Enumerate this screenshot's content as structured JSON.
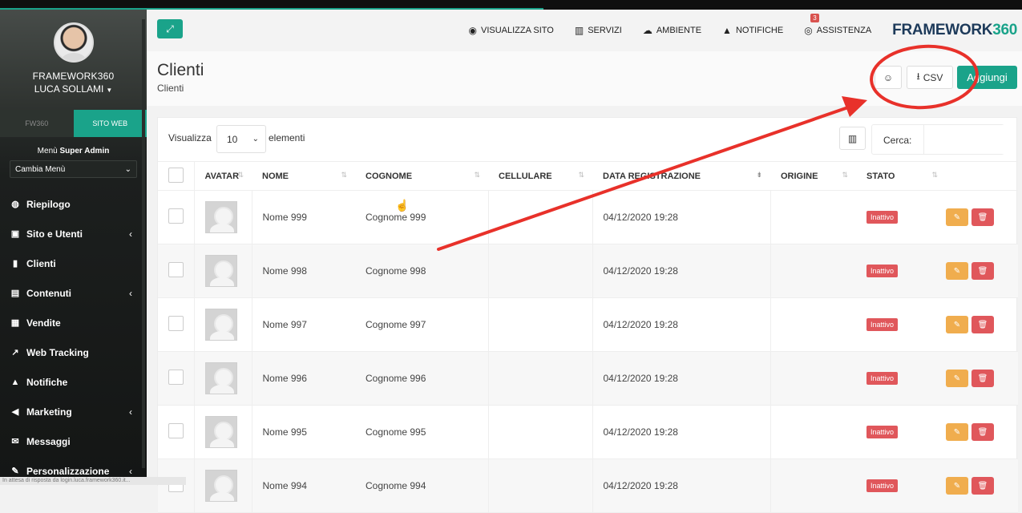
{
  "sidebar": {
    "brand": "FRAMEWORK360",
    "user": "LUCA SOLLAMI",
    "tabs": [
      {
        "label": "FW360"
      },
      {
        "label": "SITO WEB"
      }
    ],
    "menu_label_prefix": "Menù ",
    "menu_label_bold": "Super Admin",
    "menu_select": "Cambia Menù",
    "items": [
      {
        "label": "Riepilogo",
        "icon": "dashboard-icon",
        "chevron": false
      },
      {
        "label": "Sito e Utenti",
        "icon": "briefcase-icon",
        "chevron": true
      },
      {
        "label": "Clienti",
        "icon": "user-icon",
        "chevron": false
      },
      {
        "label": "Contenuti",
        "icon": "file-icon",
        "chevron": true
      },
      {
        "label": "Vendite",
        "icon": "calculator-icon",
        "chevron": false
      },
      {
        "label": "Web Tracking",
        "icon": "chart-icon",
        "chevron": false
      },
      {
        "label": "Notifiche",
        "icon": "bell-icon",
        "chevron": false
      },
      {
        "label": "Marketing",
        "icon": "megaphone-icon",
        "chevron": true
      },
      {
        "label": "Messaggi",
        "icon": "envelope-icon",
        "chevron": false
      },
      {
        "label": "Personalizzazione",
        "icon": "brush-icon",
        "chevron": true
      }
    ]
  },
  "status_bar": "In attesa di risposta da login.luca.framework360.it...",
  "header": {
    "nav": [
      {
        "label": "VISUALIZZA SITO",
        "icon": "eye-icon"
      },
      {
        "label": "SERVIZI",
        "icon": "building-icon"
      },
      {
        "label": "AMBIENTE",
        "icon": "cloud-icon"
      },
      {
        "label": "NOTIFICHE",
        "icon": "bell-icon"
      },
      {
        "label": "ASSISTENZA",
        "icon": "support-icon",
        "badge": "3"
      }
    ],
    "logo_a": "FRAMEWORK",
    "logo_b": "360"
  },
  "page": {
    "title": "Clienti",
    "subtitle": "Clienti",
    "csv_label": "CSV",
    "add_label": "Aggiungi"
  },
  "table_controls": {
    "show_label": "Visualizza",
    "page_size": "10",
    "show_after": "elementi",
    "search_label": "Cerca:",
    "search_value": ""
  },
  "table": {
    "columns": [
      "AVATAR",
      "NOME",
      "COGNOME",
      "CELLULARE",
      "DATA REGISTRAZIONE",
      "ORIGINE",
      "STATO"
    ],
    "rows": [
      {
        "nome": "Nome 999",
        "cognome": "Cognome 999",
        "cellulare": "",
        "data": "04/12/2020 19:28",
        "origine": "",
        "stato": "Inattivo"
      },
      {
        "nome": "Nome 998",
        "cognome": "Cognome 998",
        "cellulare": "",
        "data": "04/12/2020 19:28",
        "origine": "",
        "stato": "Inattivo"
      },
      {
        "nome": "Nome 997",
        "cognome": "Cognome 997",
        "cellulare": "",
        "data": "04/12/2020 19:28",
        "origine": "",
        "stato": "Inattivo"
      },
      {
        "nome": "Nome 996",
        "cognome": "Cognome 996",
        "cellulare": "",
        "data": "04/12/2020 19:28",
        "origine": "",
        "stato": "Inattivo"
      },
      {
        "nome": "Nome 995",
        "cognome": "Cognome 995",
        "cellulare": "",
        "data": "04/12/2020 19:28",
        "origine": "",
        "stato": "Inattivo"
      },
      {
        "nome": "Nome 994",
        "cognome": "Cognome 994",
        "cellulare": "",
        "data": "04/12/2020 19:28",
        "origine": "",
        "stato": "Inattivo"
      }
    ]
  },
  "colors": {
    "accent": "#1aa38a",
    "danger": "#e0575b",
    "warning": "#f0ad4e",
    "annotation": "#e8312a"
  }
}
